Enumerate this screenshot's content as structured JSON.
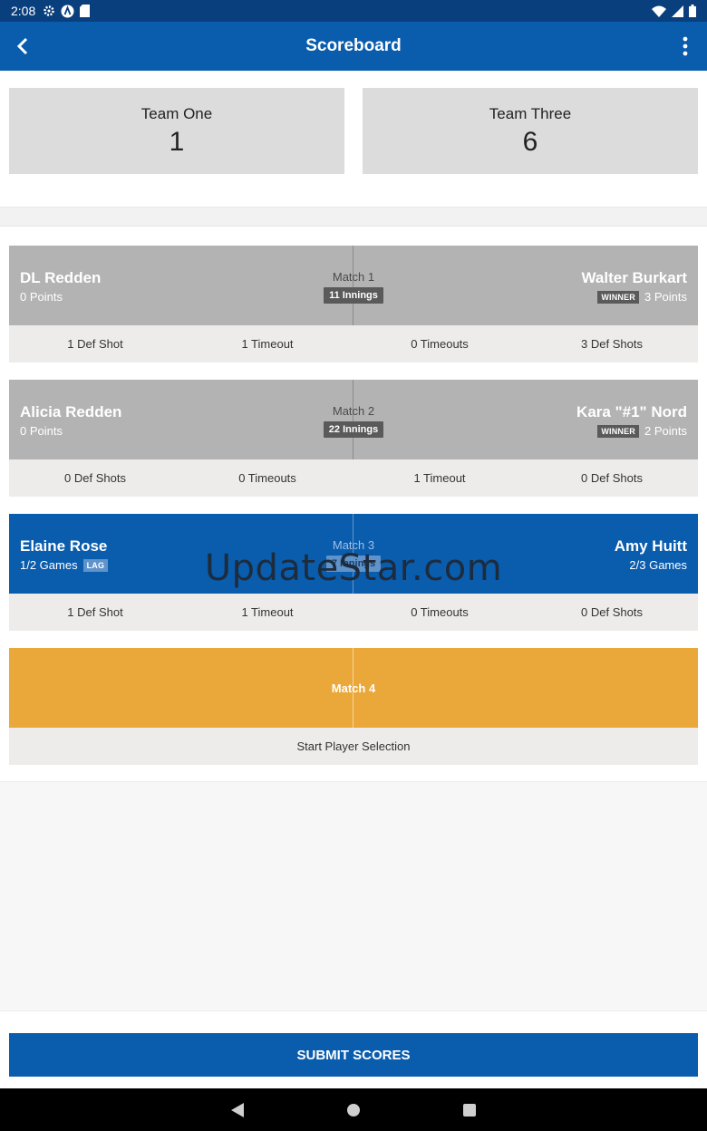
{
  "status_bar": {
    "time": "2:08"
  },
  "app_bar": {
    "title": "Scoreboard"
  },
  "teams": [
    {
      "name": "Team One",
      "score": "1"
    },
    {
      "name": "Team Three",
      "score": "6"
    }
  ],
  "matches": [
    {
      "label": "Match 1",
      "innings": "11 Innings",
      "left_player": {
        "name": "DL Redden",
        "sub": "0 Points"
      },
      "right_player": {
        "name": "Walter Burkart",
        "sub": "3 Points",
        "badge": "WINNER"
      },
      "stats": [
        "1 Def Shot",
        "1 Timeout",
        "0 Timeouts",
        "3 Def Shots"
      ]
    },
    {
      "label": "Match 2",
      "innings": "22 Innings",
      "left_player": {
        "name": "Alicia Redden",
        "sub": "0 Points"
      },
      "right_player": {
        "name": "Kara \"#1\" Nord",
        "sub": "2 Points",
        "badge": "WINNER"
      },
      "stats": [
        "0 Def Shots",
        "0 Timeouts",
        "1 Timeout",
        "0 Def Shots"
      ]
    },
    {
      "label": "Match 3",
      "innings": "7 Innings",
      "left_player": {
        "name": "Elaine Rose",
        "sub": "1/2 Games",
        "badge": "LAG"
      },
      "right_player": {
        "name": "Amy Huitt",
        "sub": "2/3 Games"
      },
      "stats": [
        "1 Def Shot",
        "1 Timeout",
        "0 Timeouts",
        "0 Def Shots"
      ]
    },
    {
      "label": "Match 4",
      "action": "Start Player Selection"
    }
  ],
  "watermark": "UpdateStar.com",
  "submit_label": "SUBMIT SCORES",
  "colors": {
    "primary": "#0a5cad",
    "match_gray": "#b3b3b3",
    "match_pending": "#eba83a"
  }
}
